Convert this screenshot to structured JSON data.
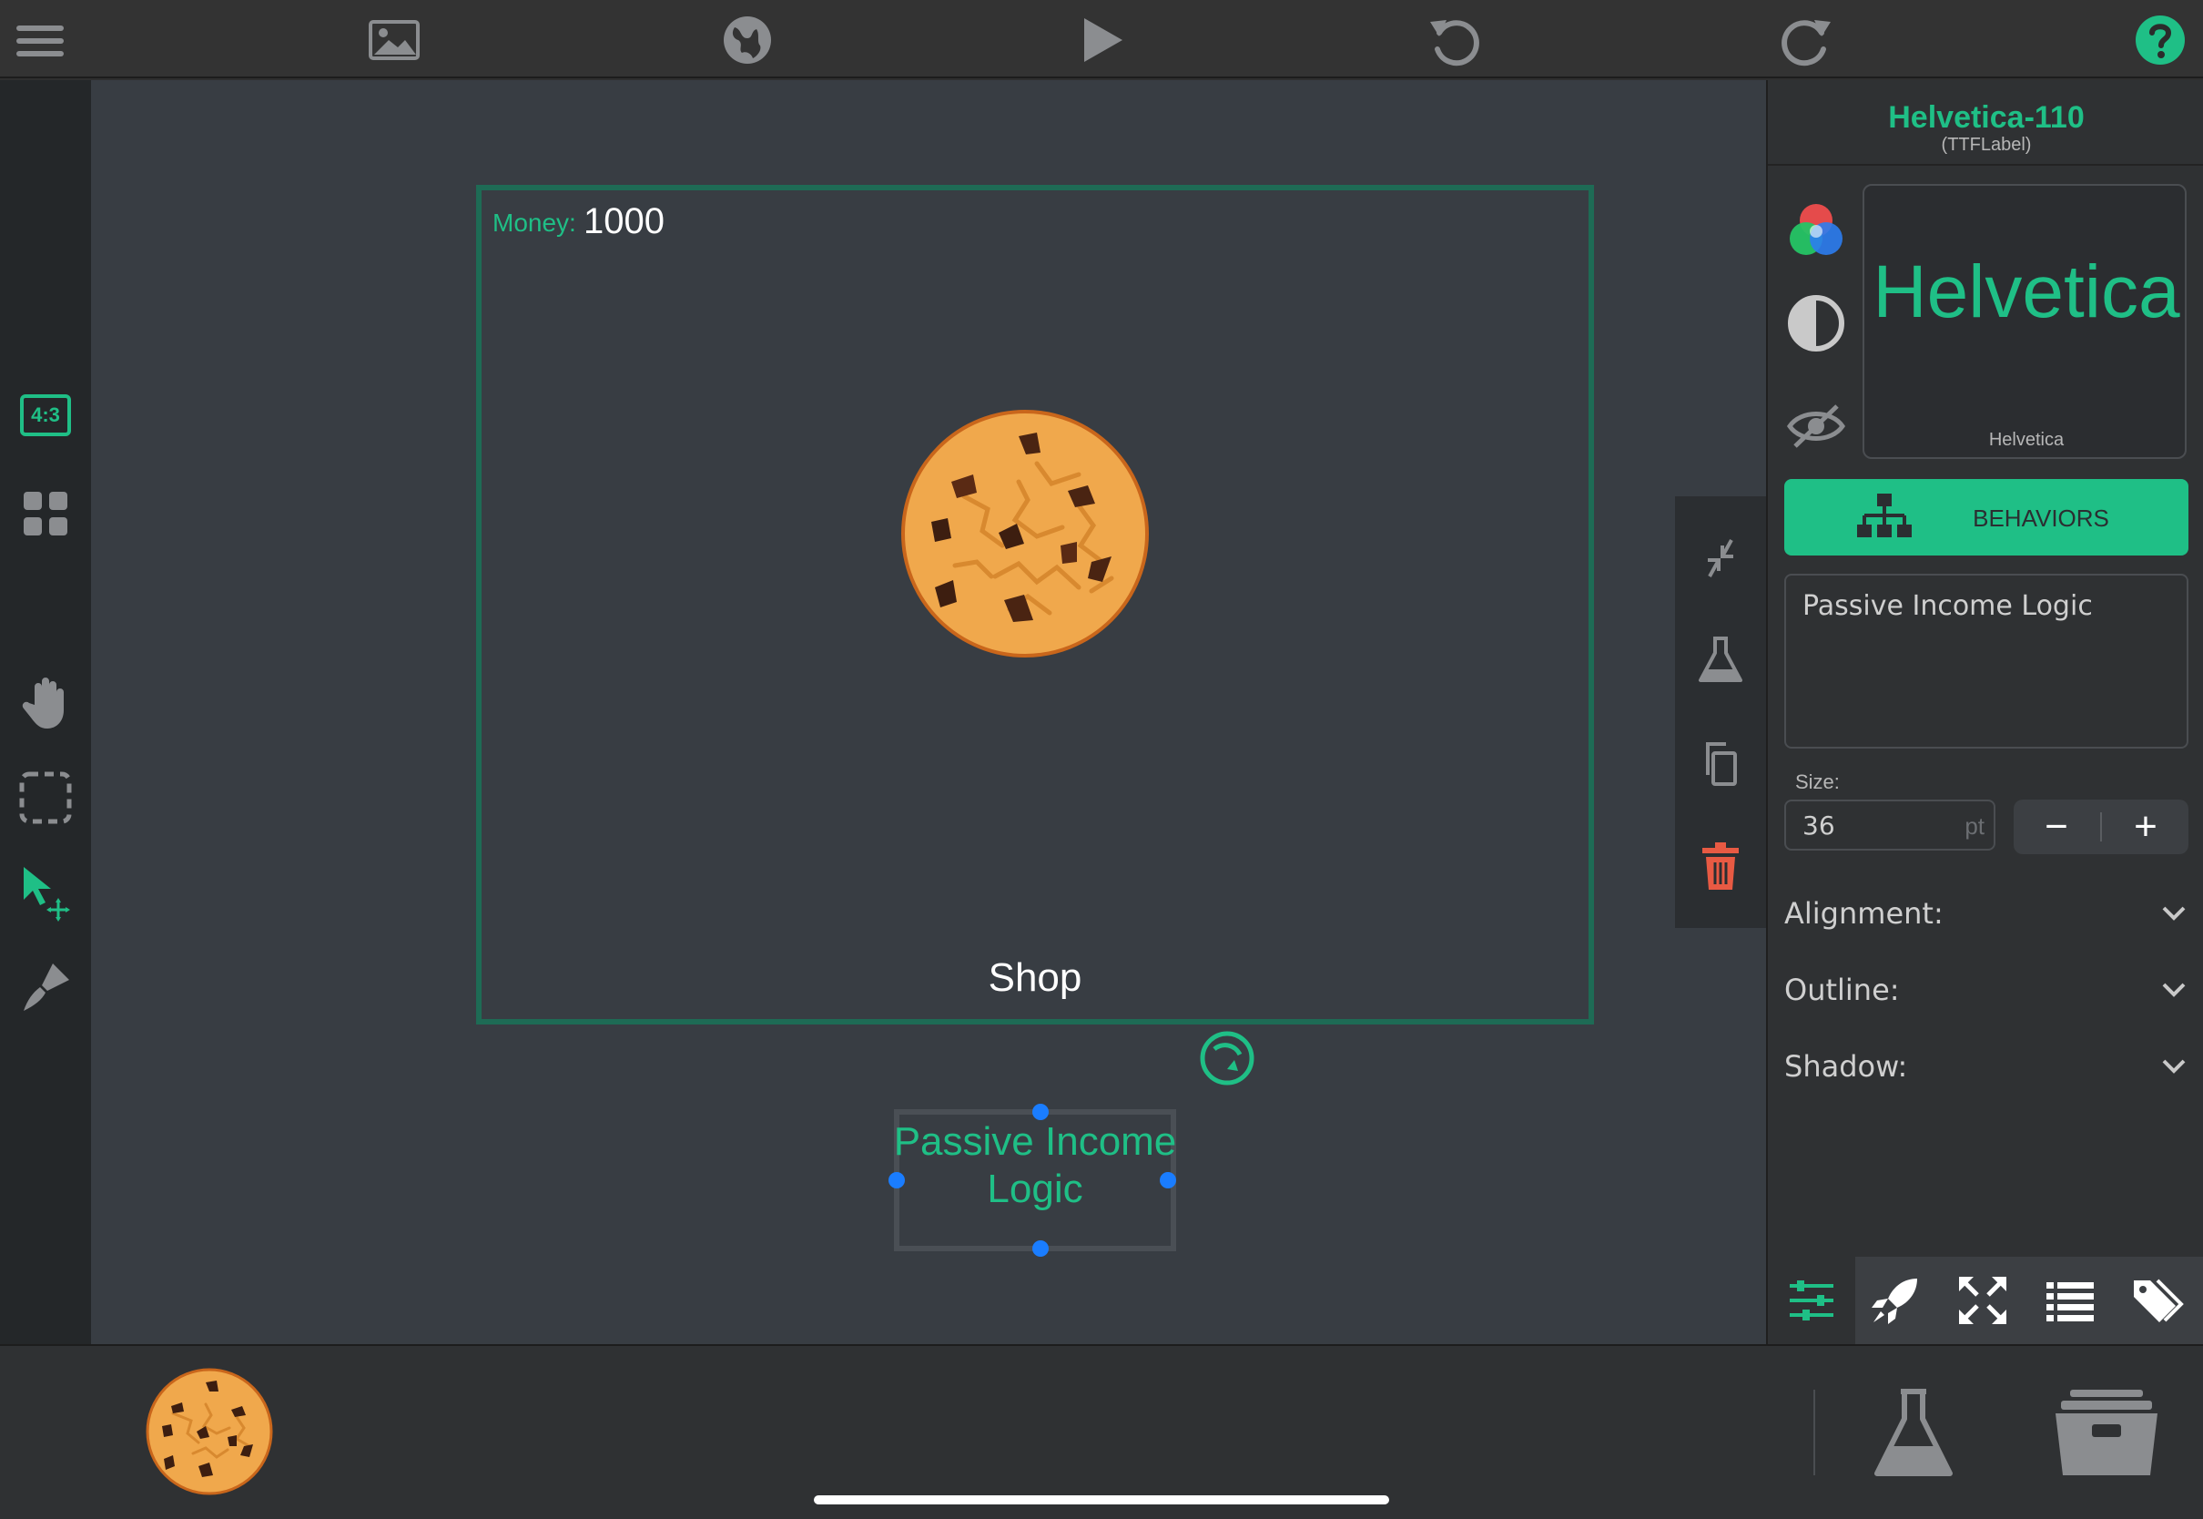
{
  "colors": {
    "accent": "#1fbf86",
    "canvas_bg": "#383d43",
    "scene_border": "#1e6b55",
    "selection_handle": "#1a7dff",
    "delete": "#e85a43"
  },
  "toolbar": {
    "icons": [
      "menu-icon",
      "image-icon",
      "globe-icon",
      "play-icon",
      "undo-icon",
      "redo-icon",
      "help-icon"
    ]
  },
  "left_rail": {
    "aspect_badge": "4:3",
    "icons": [
      "aspect-ratio-icon",
      "grid-icon",
      "hand-icon",
      "marquee-select-icon",
      "pointer-move-icon",
      "paint-brush-icon"
    ]
  },
  "scene": {
    "money_label": "Money:",
    "money_value": "1000",
    "shop_label": "Shop",
    "selected_text_line1": "Passive Income",
    "selected_text_line2": "Logic"
  },
  "float_tools": {
    "icons": [
      "collapse-icon",
      "flask-icon",
      "copy-icon",
      "trash-icon"
    ]
  },
  "inspector": {
    "object_name": "Helvetica-110",
    "object_type": "(TTFLabel)",
    "preview_text": "Helvetica",
    "preview_font": "Helvetica",
    "behaviors_label": "BEHAVIORS",
    "text_value": "Passive Income Logic",
    "size_label": "Size:",
    "size_value": "36",
    "size_unit": "pt",
    "minus": "−",
    "plus": "+",
    "alignment_label": "Alignment:",
    "outline_label": "Outline:",
    "shadow_label": "Shadow:",
    "tabs": [
      "sliders-icon",
      "rocket-icon",
      "expand-icon",
      "list-icon",
      "tag-icon"
    ]
  },
  "dock": {
    "items": [
      "cookie-asset",
      "flask-icon",
      "archive-icon"
    ]
  }
}
